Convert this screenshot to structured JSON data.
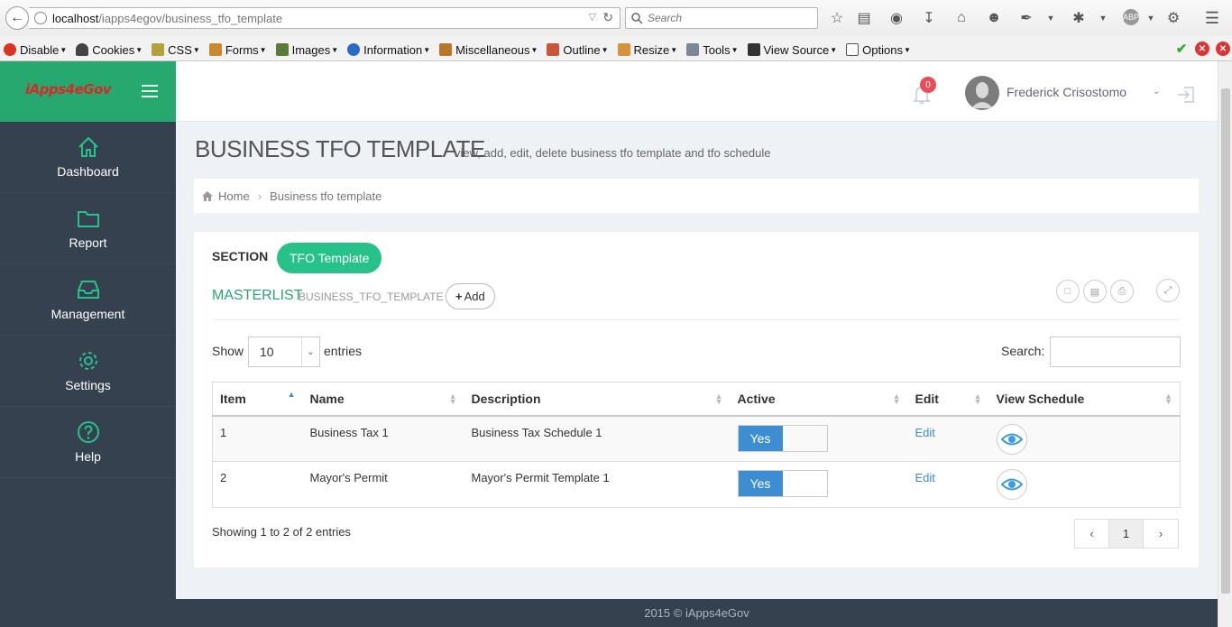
{
  "browser": {
    "url_host": "localhost",
    "url_path": "/iapps4egov/business_tfo_template",
    "search_placeholder": "Search"
  },
  "devtoolbar": {
    "items": [
      "Disable",
      "Cookies",
      "CSS",
      "Forms",
      "Images",
      "Information",
      "Miscellaneous",
      "Outline",
      "Resize",
      "Tools",
      "View Source",
      "Options"
    ]
  },
  "app": {
    "brand": "iApps4eGov",
    "notification_count": "0",
    "user_name": "Frederick Crisostomo"
  },
  "sidebar": {
    "items": [
      {
        "label": "Dashboard",
        "icon": "home-icon"
      },
      {
        "label": "Report",
        "icon": "folder-icon"
      },
      {
        "label": "Management",
        "icon": "inbox-icon"
      },
      {
        "label": "Settings",
        "icon": "gear-icon"
      },
      {
        "label": "Help",
        "icon": "help-icon"
      }
    ]
  },
  "page": {
    "title": "BUSINESS TFO TEMPLATE",
    "subtitle": "view, add, edit, delete business tfo template and tfo schedule",
    "breadcrumb": [
      "Home",
      "Business tfo template"
    ]
  },
  "portlet": {
    "section_label": "SECTION",
    "section_pill": "TFO Template",
    "masterlist_label": "MASTERLIST",
    "masterlist_sub": "BUSINESS_TFO_TEMPLATE",
    "add_label": "Add"
  },
  "datatable": {
    "show_label": "Show",
    "page_size": "10",
    "entries_label": "entries",
    "search_label": "Search:",
    "columns": [
      "Item",
      "Name",
      "Description",
      "Active",
      "Edit",
      "View Schedule"
    ],
    "rows": [
      {
        "item": "1",
        "name": "Business Tax 1",
        "description": "Business Tax Schedule 1",
        "active": "Yes",
        "edit": "Edit"
      },
      {
        "item": "2",
        "name": "Mayor's Permit",
        "description": "Mayor's Permit Template 1",
        "active": "Yes",
        "edit": "Edit"
      }
    ],
    "info": "Showing 1 to 2 of 2 entries",
    "pager": {
      "prev": "‹",
      "current": "1",
      "next": "›"
    }
  },
  "footer": {
    "text": "2015 © iApps4eGov"
  },
  "colors": {
    "brand_green": "#27a86f",
    "sidebar": "#364150",
    "pill": "#27c289",
    "toggle_on": "#3d8ed1",
    "link": "#3b8dd1"
  }
}
